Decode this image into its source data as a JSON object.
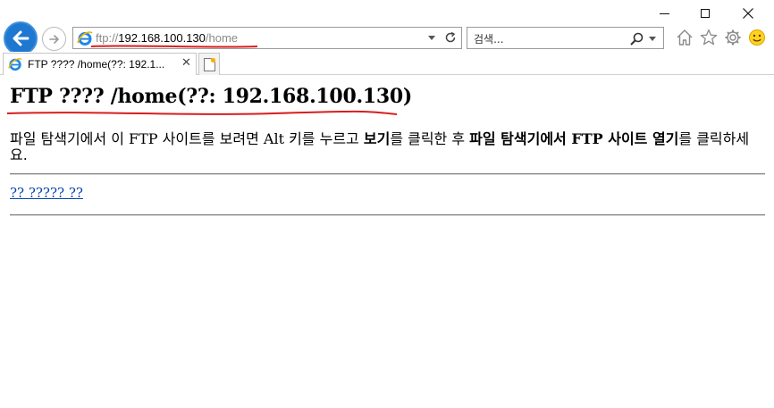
{
  "window": {
    "minimize_icon": "minimize-icon",
    "maximize_icon": "maximize-icon",
    "close_icon": "close-icon"
  },
  "address_bar": {
    "url_scheme": "ftp://",
    "url_host": "192.168.100.130",
    "url_path": "/home",
    "icons": [
      "ie-icon",
      "dropdown-arrow-icon",
      "refresh-icon"
    ]
  },
  "search": {
    "placeholder": "검색..."
  },
  "toolbar_icons": [
    "home-icon",
    "star-icon",
    "gear-icon",
    "smiley-icon"
  ],
  "tab": {
    "title": "FTP ???? /home(??: 192.1...",
    "close": "✕"
  },
  "page": {
    "title": "FTP ???? /home(??: 192.168.100.130)",
    "instructions": {
      "part1": "파일 탐색기에서 이 ",
      "ftp1": "FTP",
      "part2": " 사이트를 보려면 ",
      "alt": "Alt",
      "part3": " 키를 누르고 ",
      "bold1": "보기",
      "part4": "를 클릭한 후 ",
      "bold2a": "파일 탐색기에서 ",
      "bold2ftp": "FTP",
      "bold2b": " 사이트 열기",
      "part5": "를 클릭하세요."
    },
    "parent_link": "?? ????? ??"
  },
  "annotations": {
    "highlight_color": "#d81e1e"
  }
}
